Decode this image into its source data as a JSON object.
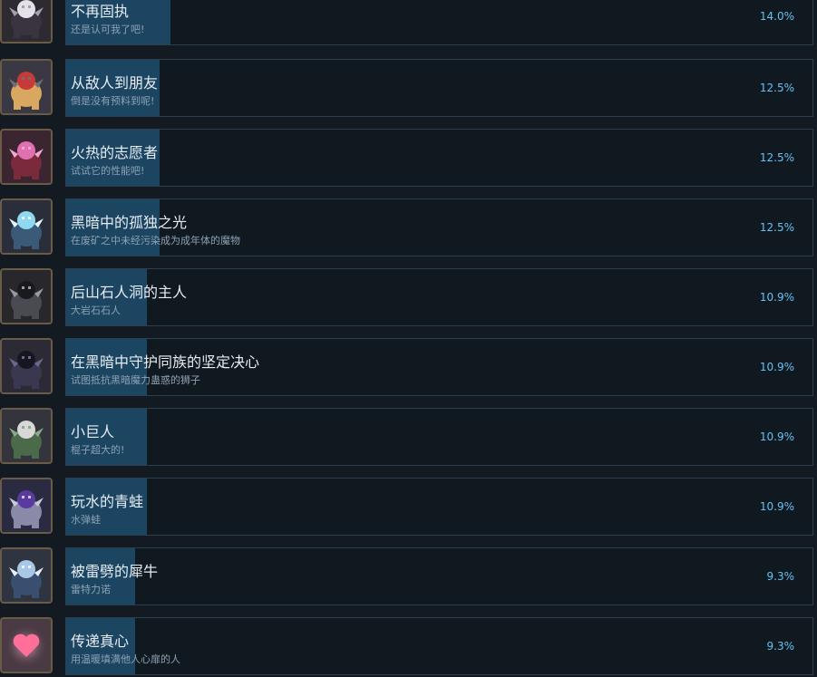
{
  "achievements": [
    {
      "title": "不再固执",
      "desc": "还是认可我了吧!",
      "percent": "14.0%",
      "fill_pct": 14.0,
      "icon": "werewolf-icon",
      "bg": "#2d2a30",
      "c1": "#e6e1e8",
      "c2": "#3a3340",
      "c3": "#a0a0b0"
    },
    {
      "title": "从敌人到朋友",
      "desc": "倒是没有预料到呢!",
      "percent": "12.5%",
      "fill_pct": 12.5,
      "icon": "red-scarf-knight-icon",
      "bg": "#3a3842",
      "c1": "#c83a3a",
      "c2": "#d9a860",
      "c3": "#6e6e7a"
    },
    {
      "title": "火热的志愿者",
      "desc": "试试它的性能吧!",
      "percent": "12.5%",
      "fill_pct": 12.5,
      "icon": "pink-robot-icon",
      "bg": "#3a2530",
      "c1": "#e070b0",
      "c2": "#7a2a3a",
      "c3": "#f0a8d0"
    },
    {
      "title": "黑暗中的孤独之光",
      "desc": "在废矿之中未经污染成为成年体的魔物",
      "percent": "12.5%",
      "fill_pct": 12.5,
      "icon": "crystal-beast-icon",
      "bg": "#2a2e3a",
      "c1": "#8fd8f0",
      "c2": "#3a5a78",
      "c3": "#e8f8ff"
    },
    {
      "title": "后山石人洞的主人",
      "desc": "大岩石石人",
      "percent": "10.9%",
      "fill_pct": 10.9,
      "icon": "rock-golem-icon",
      "bg": "#28282c",
      "c1": "#1a1a1e",
      "c2": "#4a4a52",
      "c3": "#9a9aa4"
    },
    {
      "title": "在黑暗中守护同族的坚定决心",
      "desc": "试图抵抗黑暗魔力蛊惑的狮子",
      "percent": "10.9%",
      "fill_pct": 10.9,
      "icon": "dark-lion-icon",
      "bg": "#2c2a34",
      "c1": "#161620",
      "c2": "#3a3850",
      "c3": "#6a6890"
    },
    {
      "title": "小巨人",
      "desc": "棍子超大的!",
      "percent": "10.9%",
      "fill_pct": 10.9,
      "icon": "club-goblin-icon",
      "bg": "#34343c",
      "c1": "#d8d8d8",
      "c2": "#4a6a4a",
      "c3": "#8aa88a"
    },
    {
      "title": "玩水的青蛙",
      "desc": "水弹蛙",
      "percent": "10.9%",
      "fill_pct": 10.9,
      "icon": "wizard-frog-icon",
      "bg": "#2a2a40",
      "c1": "#5a3aa0",
      "c2": "#8a8aa8",
      "c3": "#c8c8d8"
    },
    {
      "title": "被雷劈的犀牛",
      "desc": "雷特力诺",
      "percent": "9.3%",
      "fill_pct": 9.3,
      "icon": "thunder-rhino-icon",
      "bg": "#2e3440",
      "c1": "#a8c8e8",
      "c2": "#3a4e70",
      "c3": "#e8f0ff"
    },
    {
      "title": "传递真心",
      "desc": "用温暖填满他人心扉的人",
      "percent": "9.3%",
      "fill_pct": 9.3,
      "icon": "heart-icon",
      "bg": "#4a3a44",
      "c1": "#ff6f9a",
      "c2": "#ffb6cc",
      "c3": "#7a4a5a"
    }
  ]
}
